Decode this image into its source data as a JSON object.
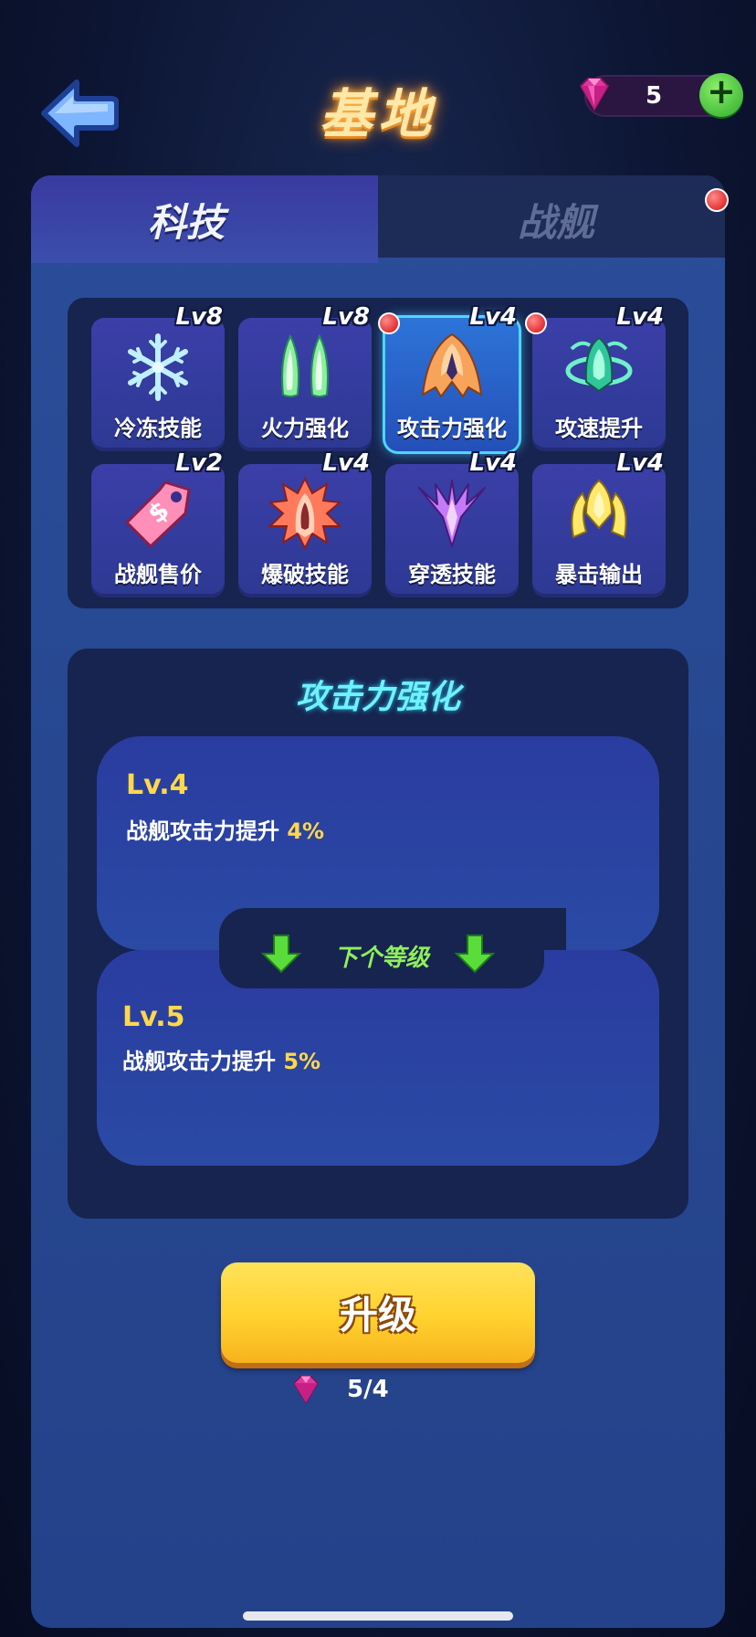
{
  "header": {
    "title": "基地",
    "gem_count": "5",
    "icons": {
      "back": "back-arrow-icon",
      "gem": "gem-icon",
      "add": "plus-icon"
    }
  },
  "tabs": [
    {
      "label": "科技",
      "active": true
    },
    {
      "label": "战舰",
      "active": false,
      "notification": true
    }
  ],
  "skills": [
    {
      "name": "冷冻技能",
      "level": "Lv8",
      "icon": "snowflake-icon",
      "notification": false,
      "selected": false
    },
    {
      "name": "火力强化",
      "level": "Lv8",
      "icon": "twin-flames-icon",
      "notification": false,
      "selected": false
    },
    {
      "name": "攻击力强化",
      "level": "Lv4",
      "icon": "attack-ship-icon",
      "notification": true,
      "selected": true
    },
    {
      "name": "攻速提升",
      "level": "Lv4",
      "icon": "speed-orbit-icon",
      "notification": true,
      "selected": false
    },
    {
      "name": "战舰售价",
      "level": "Lv2",
      "icon": "price-tag-icon",
      "notification": false,
      "selected": false
    },
    {
      "name": "爆破技能",
      "level": "Lv4",
      "icon": "blast-icon",
      "notification": false,
      "selected": false
    },
    {
      "name": "穿透技能",
      "level": "Lv4",
      "icon": "pierce-icon",
      "notification": false,
      "selected": false
    },
    {
      "name": "暴击输出",
      "level": "Lv4",
      "icon": "crit-crown-icon",
      "notification": false,
      "selected": false
    }
  ],
  "detail": {
    "title": "攻击力强化",
    "current": {
      "level": "Lv.4",
      "desc": "战舰攻击力提升",
      "pct": "4%"
    },
    "next_label": "下个等级",
    "next": {
      "level": "Lv.5",
      "desc": "战舰攻击力提升",
      "pct": "5%"
    }
  },
  "upgrade": {
    "label": "升级",
    "cost": "5/4"
  },
  "colors": {
    "accent_gold": "#ffd84a",
    "title_cyan": "#6ff2ff",
    "next_green": "#8ef05a",
    "panel": "#16244f"
  }
}
